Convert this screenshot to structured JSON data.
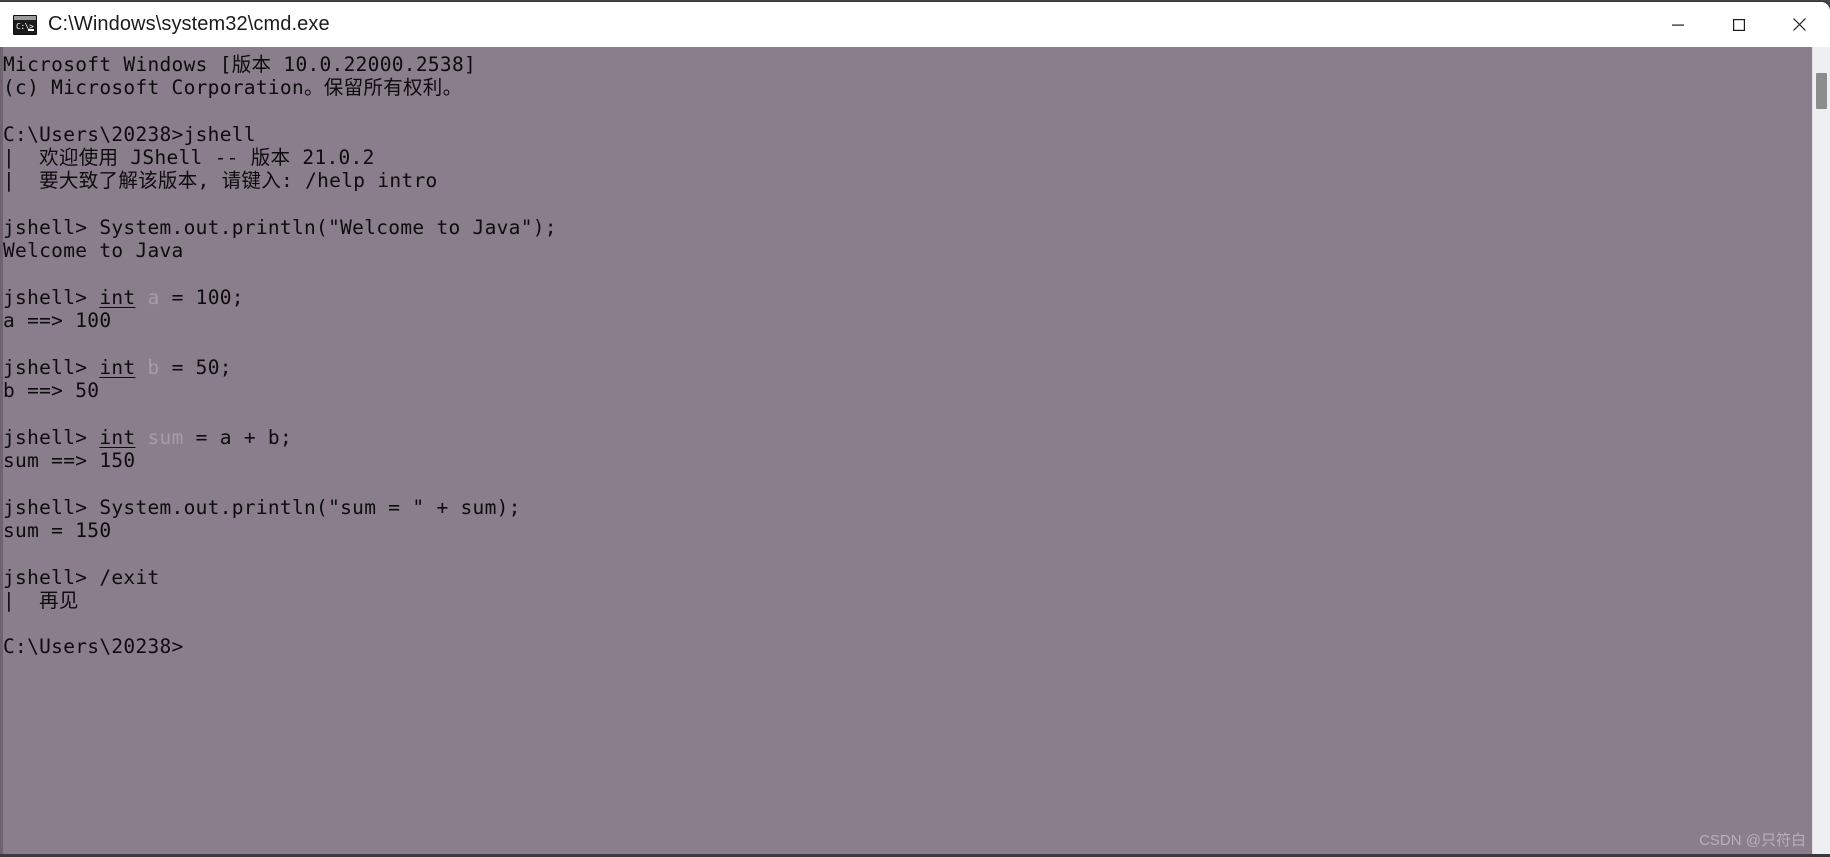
{
  "window": {
    "title": "C:\\Windows\\system32\\cmd.exe",
    "icon": "cmd-icon",
    "icon_prompt_text": "C:\\>",
    "controls": {
      "minimize_label": "Minimize",
      "maximize_label": "Maximize",
      "close_label": "Close"
    },
    "colors": {
      "titlebar_bg": "#ffffff",
      "title_text": "#1b1b1b",
      "terminal_bg": "#8a7e8c",
      "terminal_fg": "#0c0c0c",
      "terminal_dim_fg": "#a79ca8",
      "scrollbar_track": "#efeff2",
      "scrollbar_thumb": "#8c8c8c",
      "watermark": "#b9afba"
    }
  },
  "terminal": {
    "lines": [
      {
        "id": "l01",
        "segments": [
          {
            "text": "Microsoft Windows [版本 10.0.22000.2538]",
            "style": "normal"
          }
        ]
      },
      {
        "id": "l02",
        "segments": [
          {
            "text": "(c) Microsoft Corporation。保留所有权利。",
            "style": "normal"
          }
        ]
      },
      {
        "id": "l03",
        "segments": [
          {
            "text": "",
            "style": "normal"
          }
        ]
      },
      {
        "id": "l04",
        "segments": [
          {
            "text": "C:\\Users\\20238>jshell",
            "style": "normal"
          }
        ]
      },
      {
        "id": "l05",
        "segments": [
          {
            "text": "|  欢迎使用 JShell -- 版本 21.0.2",
            "style": "normal"
          }
        ]
      },
      {
        "id": "l06",
        "segments": [
          {
            "text": "|  要大致了解该版本, 请键入: /help intro",
            "style": "normal"
          }
        ]
      },
      {
        "id": "l07",
        "segments": [
          {
            "text": "",
            "style": "normal"
          }
        ]
      },
      {
        "id": "l08",
        "segments": [
          {
            "text": "jshell> System.out.println(\"Welcome to Java\");",
            "style": "normal"
          }
        ]
      },
      {
        "id": "l09",
        "segments": [
          {
            "text": "Welcome to Java",
            "style": "normal"
          }
        ]
      },
      {
        "id": "l10",
        "segments": [
          {
            "text": "",
            "style": "normal"
          }
        ]
      },
      {
        "id": "l11",
        "segments": [
          {
            "text": "jshell> ",
            "style": "normal"
          },
          {
            "text": "int",
            "style": "underline"
          },
          {
            "text": " ",
            "style": "normal"
          },
          {
            "text": "a",
            "style": "dim"
          },
          {
            "text": " = 100;",
            "style": "normal"
          }
        ]
      },
      {
        "id": "l12",
        "segments": [
          {
            "text": "a ==> 100",
            "style": "normal"
          }
        ]
      },
      {
        "id": "l13",
        "segments": [
          {
            "text": "",
            "style": "normal"
          }
        ]
      },
      {
        "id": "l14",
        "segments": [
          {
            "text": "jshell> ",
            "style": "normal"
          },
          {
            "text": "int",
            "style": "underline"
          },
          {
            "text": " ",
            "style": "normal"
          },
          {
            "text": "b",
            "style": "dim"
          },
          {
            "text": " = 50;",
            "style": "normal"
          }
        ]
      },
      {
        "id": "l15",
        "segments": [
          {
            "text": "b ==> 50",
            "style": "normal"
          }
        ]
      },
      {
        "id": "l16",
        "segments": [
          {
            "text": "",
            "style": "normal"
          }
        ]
      },
      {
        "id": "l17",
        "segments": [
          {
            "text": "jshell> ",
            "style": "normal"
          },
          {
            "text": "int",
            "style": "underline"
          },
          {
            "text": " ",
            "style": "normal"
          },
          {
            "text": "sum",
            "style": "dim"
          },
          {
            "text": " = a + b;",
            "style": "normal"
          }
        ]
      },
      {
        "id": "l18",
        "segments": [
          {
            "text": "sum ==> 150",
            "style": "normal"
          }
        ]
      },
      {
        "id": "l19",
        "segments": [
          {
            "text": "",
            "style": "normal"
          }
        ]
      },
      {
        "id": "l20",
        "segments": [
          {
            "text": "jshell> System.out.println(\"sum = \" + sum);",
            "style": "normal"
          }
        ]
      },
      {
        "id": "l21",
        "segments": [
          {
            "text": "sum = 150",
            "style": "normal"
          }
        ]
      },
      {
        "id": "l22",
        "segments": [
          {
            "text": "",
            "style": "normal"
          }
        ]
      },
      {
        "id": "l23",
        "segments": [
          {
            "text": "jshell> /exit",
            "style": "normal"
          }
        ]
      },
      {
        "id": "l24",
        "segments": [
          {
            "text": "|  再见",
            "style": "normal"
          }
        ]
      },
      {
        "id": "l25",
        "segments": [
          {
            "text": "",
            "style": "normal"
          }
        ]
      },
      {
        "id": "l26",
        "segments": [
          {
            "text": "C:\\Users\\20238>",
            "style": "normal"
          }
        ]
      }
    ]
  },
  "watermark": {
    "text": "CSDN @只符白"
  }
}
